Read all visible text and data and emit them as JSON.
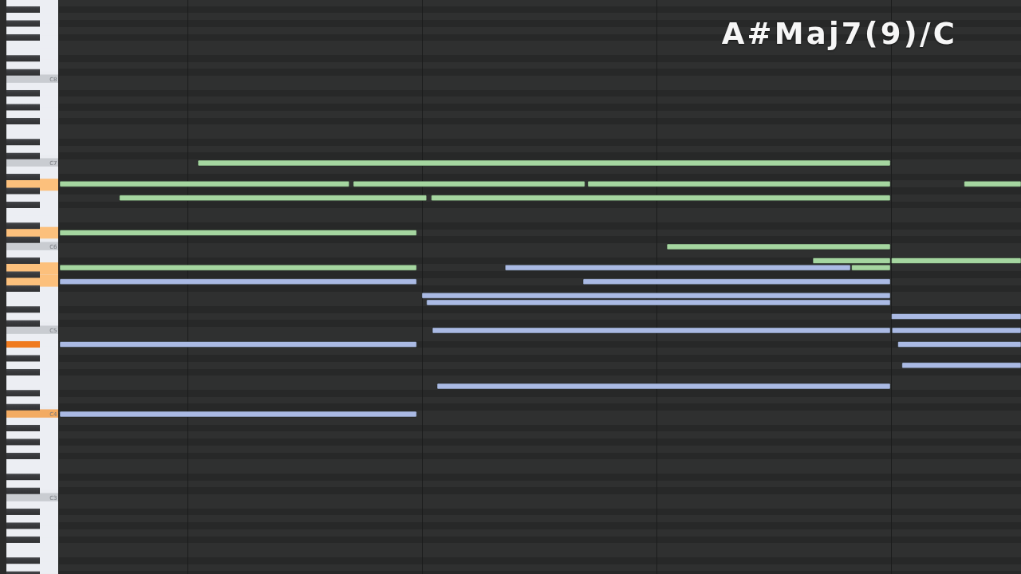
{
  "chord_name": "A#Maj7(9)/C",
  "piano_roll": {
    "octave_labels": [
      "C8",
      "C7",
      "C6",
      "C5",
      "C4",
      "C3"
    ],
    "keys": [
      {
        "highlighted": false
      },
      {
        "highlighted": false
      },
      {
        "highlighted": false
      },
      {
        "highlighted": false
      },
      {
        "highlighted": false
      },
      {
        "highlighted": false
      },
      {
        "highlighted": false
      },
      {
        "highlighted": false
      },
      {
        "highlighted": false
      },
      {
        "highlighted": false
      },
      {
        "highlighted": false
      },
      {
        "highlighted": false
      },
      {
        "highlighted": false
      },
      {
        "highlighted": false
      },
      {
        "highlighted": false
      },
      {
        "highlighted": false
      },
      {
        "highlighted": false
      },
      {
        "highlighted": false
      },
      {
        "highlighted": false
      },
      {
        "highlighted": false
      },
      {
        "highlighted": false
      },
      {
        "highlighted": false
      },
      {
        "highlighted": false
      },
      {
        "highlighted": false
      },
      {
        "highlighted": false
      },
      {
        "highlighted": false
      },
      {
        "highlighted": true
      },
      {
        "highlighted": false
      },
      {
        "highlighted": false
      },
      {
        "highlighted": false
      },
      {
        "highlighted": false
      },
      {
        "highlighted": false
      },
      {
        "highlighted": false
      },
      {
        "highlighted": true
      },
      {
        "highlighted": false
      },
      {
        "highlighted": false
      },
      {
        "highlighted": false
      },
      {
        "highlighted": false
      },
      {
        "highlighted": true
      },
      {
        "highlighted": false
      },
      {
        "highlighted": true
      },
      {
        "highlighted": false
      },
      {
        "highlighted": false
      },
      {
        "highlighted": false
      },
      {
        "highlighted": false
      },
      {
        "highlighted": false
      },
      {
        "highlighted": false
      },
      {
        "highlighted": false
      },
      {
        "highlighted": false
      },
      {
        "highlighted": true
      },
      {
        "highlighted": false
      },
      {
        "highlighted": false
      },
      {
        "highlighted": false
      },
      {
        "highlighted": false
      },
      {
        "highlighted": false
      },
      {
        "highlighted": false
      },
      {
        "highlighted": false
      },
      {
        "highlighted": false
      },
      {
        "highlighted": false
      },
      {
        "highlighted": true
      },
      {
        "highlighted": false
      },
      {
        "highlighted": false
      },
      {
        "highlighted": false
      },
      {
        "highlighted": false
      },
      {
        "highlighted": false
      },
      {
        "highlighted": false
      },
      {
        "highlighted": false
      },
      {
        "highlighted": false
      },
      {
        "highlighted": false
      },
      {
        "highlighted": false
      },
      {
        "highlighted": false
      },
      {
        "highlighted": false
      },
      {
        "highlighted": false
      },
      {
        "highlighted": false
      },
      {
        "highlighted": false
      },
      {
        "highlighted": false
      },
      {
        "highlighted": false
      },
      {
        "highlighted": false
      },
      {
        "highlighted": false
      },
      {
        "highlighted": false
      },
      {
        "highlighted": false
      },
      {
        "highlighted": false
      },
      {
        "highlighted": false
      }
    ],
    "notes": [
      {
        "color": "#a5d6a0"
      },
      {
        "color": "#a5d6a0"
      },
      {
        "color": "#a5d6a0"
      },
      {
        "color": "#a5d6a0"
      },
      {
        "color": "#a5d6a0"
      },
      {
        "color": "#a5d6a0"
      },
      {
        "color": "#a5d6a0"
      },
      {
        "color": "#a5d6a0"
      },
      {
        "color": "#a5d6a0"
      },
      {
        "color": "#a5d6a0"
      },
      {
        "color": "#a5d6a0"
      },
      {
        "color": "#a5d6a0"
      },
      {
        "color": "#aabae4"
      },
      {
        "color": "#a5d6a0"
      },
      {
        "color": "#aabae4"
      },
      {
        "color": "#aabae4"
      },
      {
        "color": "#aabae4"
      },
      {
        "color": "#aabae4"
      },
      {
        "color": "#aabae4"
      },
      {
        "color": "#aabae4"
      },
      {
        "color": "#aabae4"
      },
      {
        "color": "#aabae4"
      },
      {
        "color": "#aabae4"
      },
      {
        "color": "#aabae4"
      },
      {
        "color": "#aabae4"
      },
      {
        "color": "#aabae4"
      }
    ]
  }
}
